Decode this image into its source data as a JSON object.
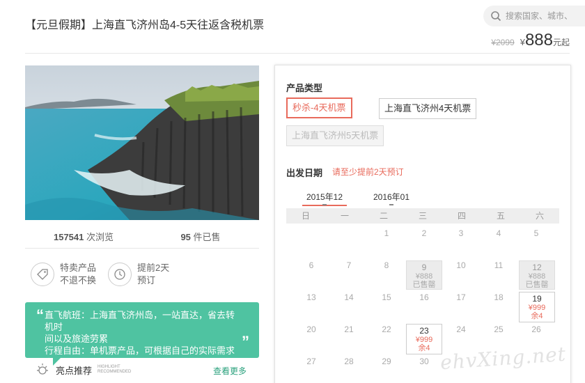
{
  "header": {
    "title": "【元旦假期】上海直飞济州岛4-5天往返含税机票",
    "search_placeholder": "搜索国家、城市、"
  },
  "price": {
    "old": "¥2099",
    "currency": "¥",
    "now": "888",
    "suffix": "元起"
  },
  "stats": {
    "views_num": "157541",
    "views_label": " 次浏览",
    "sold_num": "95",
    "sold_label": " 件已售"
  },
  "features": [
    {
      "line1": "特卖产品",
      "line2": "不退不换",
      "icon": "tag-icon"
    },
    {
      "line1": "提前2天",
      "line2": "预订",
      "icon": "clock-icon"
    }
  ],
  "highlight_box": {
    "line1": "直飞航班：上海直飞济州岛，一站直达，省去转机时",
    "line2": "间以及旅途劳累",
    "line3": "行程自由：单机票产品，可根据自己的实际需求安排"
  },
  "highlight": {
    "label": "亮点推荐",
    "en1": "HIGHLIGHT",
    "en2": "RECOMMENDED",
    "more": "查看更多"
  },
  "product": {
    "label": "产品类型",
    "options": [
      "秒杀-4天机票",
      "上海直飞济州4天机票",
      "上海直飞济州5天机票"
    ]
  },
  "departure": {
    "label": "出发日期",
    "hint": "请至少提前2天预订"
  },
  "months": [
    "2015年12",
    "2016年01"
  ],
  "weekdays": [
    "日",
    "一",
    "二",
    "三",
    "四",
    "五",
    "六"
  ],
  "calendar": {
    "row1": [
      "1",
      "2",
      "3",
      "4",
      "5"
    ],
    "row2": [
      "6",
      "7",
      "8",
      "9",
      "10",
      "11",
      "12"
    ],
    "row3": [
      "13",
      "14",
      "15",
      "16",
      "17",
      "18",
      "19"
    ],
    "row4": [
      "20",
      "21",
      "22",
      "23",
      "24",
      "25",
      "26"
    ],
    "row5": [
      "27",
      "28",
      "29",
      "30"
    ],
    "soldout_price": "¥888",
    "soldout_label": "已售罄",
    "avail_price": "¥999",
    "avail_left": "余4"
  },
  "watermark": "ehvXing.net",
  "colors": {
    "accent": "#e86a5b",
    "green": "#4fc3a1"
  }
}
